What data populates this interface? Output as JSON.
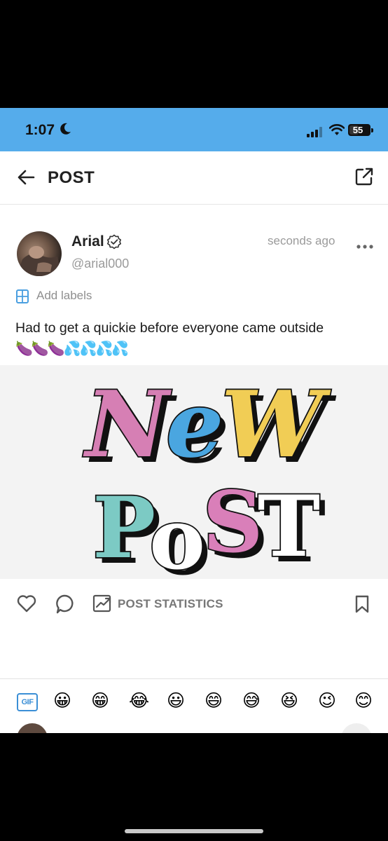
{
  "status_bar": {
    "time": "1:07",
    "battery": "55",
    "battery_level": 0.55
  },
  "header": {
    "title": "POST"
  },
  "post": {
    "author": "Arial",
    "handle": "@arial000",
    "time_ago": "seconds ago",
    "add_labels": "Add labels",
    "text": "Had to get a quickie before everyone came outside",
    "emojis": "🍆🍆🍆💦💦💦💦",
    "image": {
      "line1": "NeW",
      "line2": "PoST",
      "colors": {
        "N": "#d67fb4",
        "e": "#4aa6e0",
        "W": "#f1cd55",
        "P": "#7ccac4",
        "o": "#ffffff",
        "S": "#d97fb9",
        "T": "#ffffff",
        "outline": "#111111"
      }
    }
  },
  "actions": {
    "statistics_label": "POST STATISTICS"
  },
  "emoji_bar": {
    "gif_label": "GIF",
    "emojis": [
      "😀",
      "😁",
      "😂",
      "😃",
      "😄",
      "😅",
      "😆",
      "😉",
      "😊"
    ]
  },
  "colors": {
    "status_bar_bg": "#55aceb",
    "accent": "#3b8fd6"
  }
}
